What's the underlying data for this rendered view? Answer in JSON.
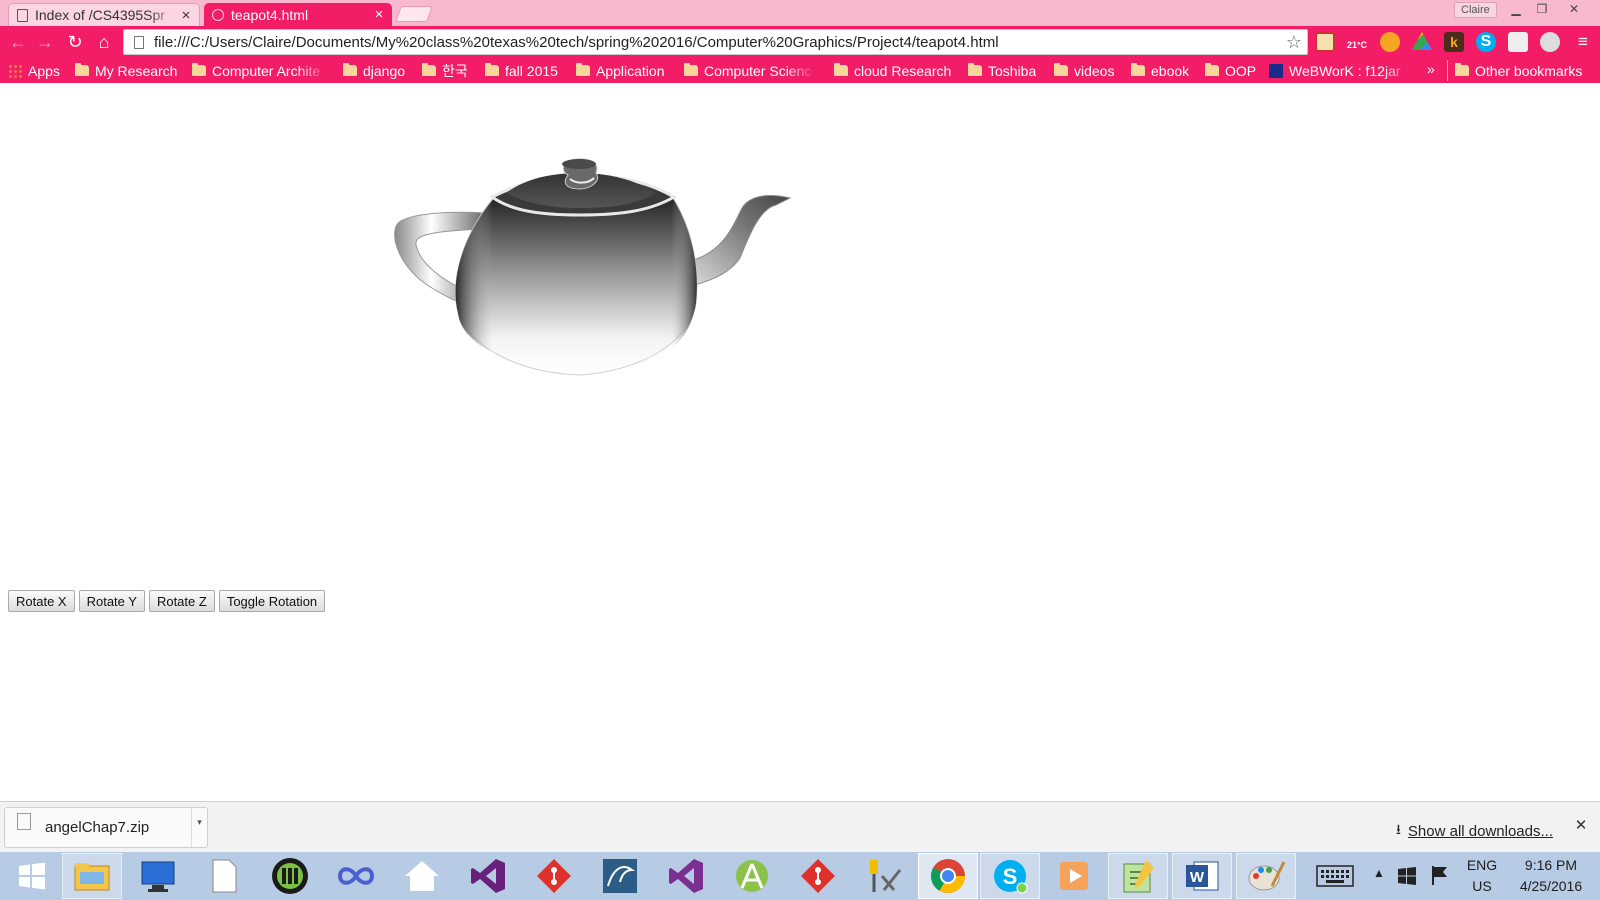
{
  "browser": {
    "tabs": [
      {
        "title": "Index of /CS4395Spr",
        "active": false
      },
      {
        "title": "teapot4.html",
        "active": true
      }
    ],
    "profile_name": "Claire",
    "url": "file:///C:/Users/Claire/Documents/My%20class%20texas%20tech/spring%202016/Computer%20Graphics/Project4/teapot4.html",
    "bookmarks": [
      {
        "label": "Apps",
        "icon": "apps-grid-icon"
      },
      {
        "label": "My Research",
        "icon": "folder-icon"
      },
      {
        "label": "Computer Archite",
        "icon": "folder-icon"
      },
      {
        "label": "django",
        "icon": "folder-icon"
      },
      {
        "label": "한국",
        "icon": "folder-icon"
      },
      {
        "label": "fall 2015",
        "icon": "folder-icon"
      },
      {
        "label": "Application",
        "icon": "folder-icon"
      },
      {
        "label": "Computer Scienc",
        "icon": "folder-icon"
      },
      {
        "label": "cloud Research",
        "icon": "folder-icon"
      },
      {
        "label": "Toshiba",
        "icon": "folder-icon"
      },
      {
        "label": "videos",
        "icon": "folder-icon"
      },
      {
        "label": "ebook",
        "icon": "folder-icon"
      },
      {
        "label": "OOP",
        "icon": "folder-icon"
      },
      {
        "label": "WeBWorK : f12jar",
        "icon": "webwork-icon"
      }
    ],
    "bookmarks_overflow": "»",
    "other_bookmarks": "Other bookmarks",
    "extension_badge": "21°C",
    "colors": {
      "chrome_accent": "#f21c67",
      "tabstrip": "#f8b9cf"
    }
  },
  "page": {
    "buttons": [
      "Rotate X",
      "Rotate Y",
      "Rotate Z",
      "Toggle Rotation"
    ]
  },
  "downloads": {
    "file_name": "angelChap7.zip",
    "show_all": "Show all downloads..."
  },
  "taskbar": {
    "apps": [
      "start-icon",
      "file-explorer-icon",
      "lenovo-icon",
      "blank-file-icon",
      "media-player-icon",
      "infinity-icon",
      "home-icon",
      "visual-studio-icon",
      "git-icon",
      "mysql-icon",
      "visual-studio-2-icon",
      "android-studio-icon",
      "git-2-icon",
      "tools-icon",
      "chrome-icon",
      "skype-icon",
      "video-icon",
      "notepad-icon",
      "word-icon",
      "paint-icon"
    ],
    "language": "ENG",
    "region": "US",
    "time": "9:16 PM",
    "date": "4/25/2016"
  }
}
